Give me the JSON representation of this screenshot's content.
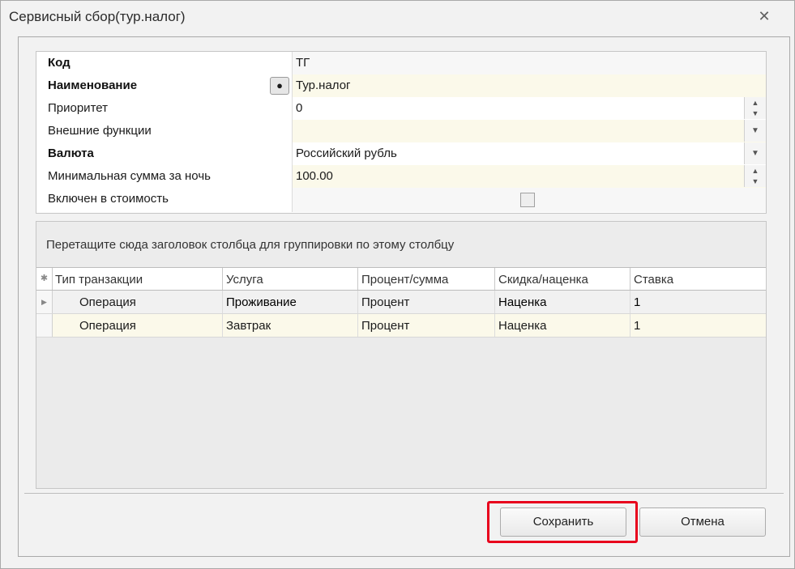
{
  "window": {
    "title": "Сервисный сбор(тур.налог)"
  },
  "properties": [
    {
      "label": "Код",
      "bold": true,
      "value": "ТГ"
    },
    {
      "label": "Наименование",
      "bold": true,
      "value": "Тур.налог"
    },
    {
      "label": "Приоритет",
      "bold": false,
      "value": "0"
    },
    {
      "label": "Внешние функции",
      "bold": false,
      "value": ""
    },
    {
      "label": "Валюта",
      "bold": true,
      "value": "Российский рубль"
    },
    {
      "label": "Минимальная сумма за ночь",
      "bold": false,
      "value": "100.00"
    },
    {
      "label": "Включен в стоимость",
      "bold": false,
      "value": ""
    }
  ],
  "grid": {
    "group_hint": "Перетащите сюда заголовок столбца для группировки по этому столбцу",
    "columns": [
      "Тип транзакции",
      "Услуга",
      "Процент/сумма",
      "Скидка/наценка",
      "Ставка"
    ],
    "rows": [
      [
        "Операция",
        "Проживание",
        "Процент",
        "Наценка",
        "1"
      ],
      [
        "Операция",
        "Завтрак",
        "Процент",
        "Наценка",
        "1"
      ]
    ]
  },
  "buttons": {
    "save": "Сохранить",
    "cancel": "Отмена"
  },
  "colors": {
    "highlight": "#e8001c",
    "editable_bg": "#fbf9ea"
  }
}
